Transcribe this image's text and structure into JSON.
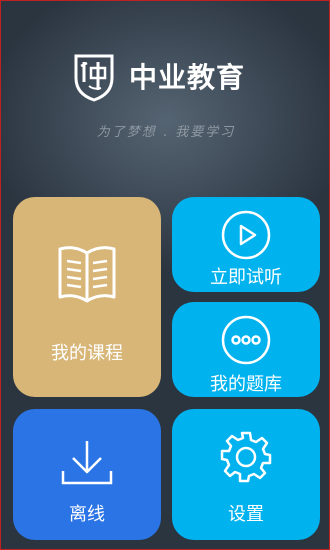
{
  "brand": {
    "name": "中业教育",
    "slogan": "为了梦想 . 我要学习",
    "logo_icon": "shield-logo-icon"
  },
  "tiles": {
    "courses": {
      "label": "我的课程",
      "icon": "book-icon",
      "color": "#d7b678"
    },
    "trial": {
      "label": "立即试听",
      "icon": "play-icon",
      "color": "#00b2ee"
    },
    "questions": {
      "label": "我的题库",
      "icon": "more-icon",
      "color": "#00b2ee"
    },
    "offline": {
      "label": "离线",
      "icon": "download-icon",
      "color": "#2b74e5"
    },
    "settings": {
      "label": "设置",
      "icon": "gear-icon",
      "color": "#00b2ee"
    }
  },
  "colors": {
    "background": "#3e4a57",
    "frame_border": "#c02020"
  }
}
